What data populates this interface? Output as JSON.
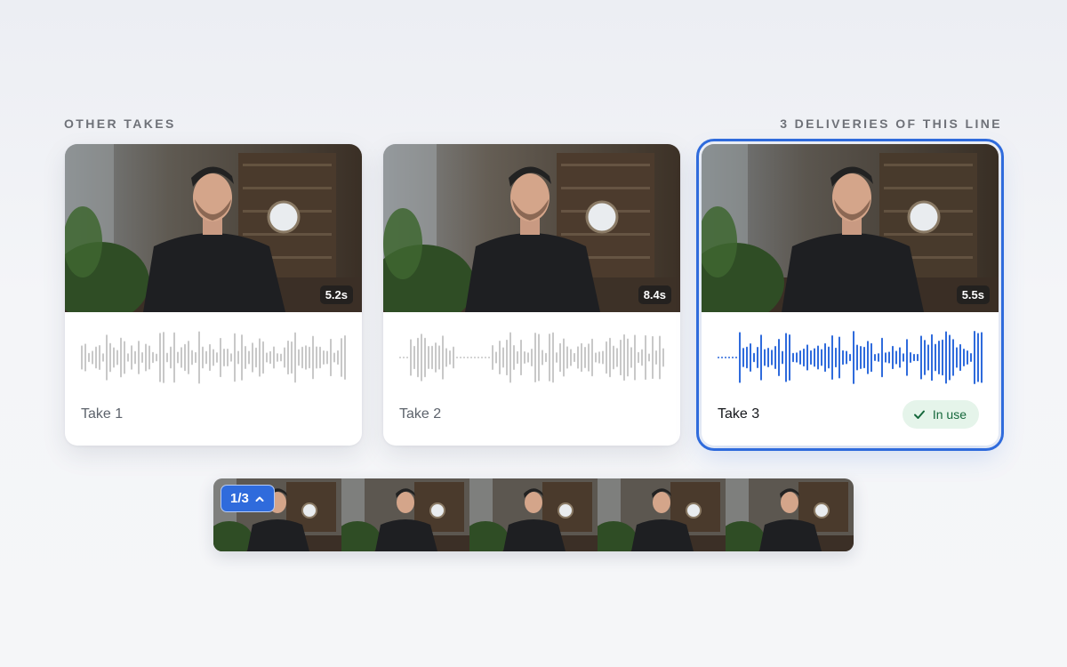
{
  "header": {
    "left_title": "OTHER TAKES",
    "right_title": "3 DELIVERIES OF THIS LINE"
  },
  "takes": [
    {
      "label": "Take 1",
      "duration": "5.2s",
      "active": false,
      "wave_color": "#c8c8c8"
    },
    {
      "label": "Take 2",
      "duration": "8.4s",
      "active": false,
      "wave_color": "#c8c8c8"
    },
    {
      "label": "Take 3",
      "duration": "5.5s",
      "active": true,
      "wave_color": "#2f6bdc",
      "status": "In use"
    }
  ],
  "filmstrip": {
    "counter": "1/3",
    "frames": 5
  },
  "colors": {
    "accent": "#2f6bdc",
    "in_use_bg": "#e5f4ea",
    "in_use_text": "#16683c"
  },
  "icons": {
    "check": "check-icon",
    "chevron": "chevron-up-icon"
  }
}
